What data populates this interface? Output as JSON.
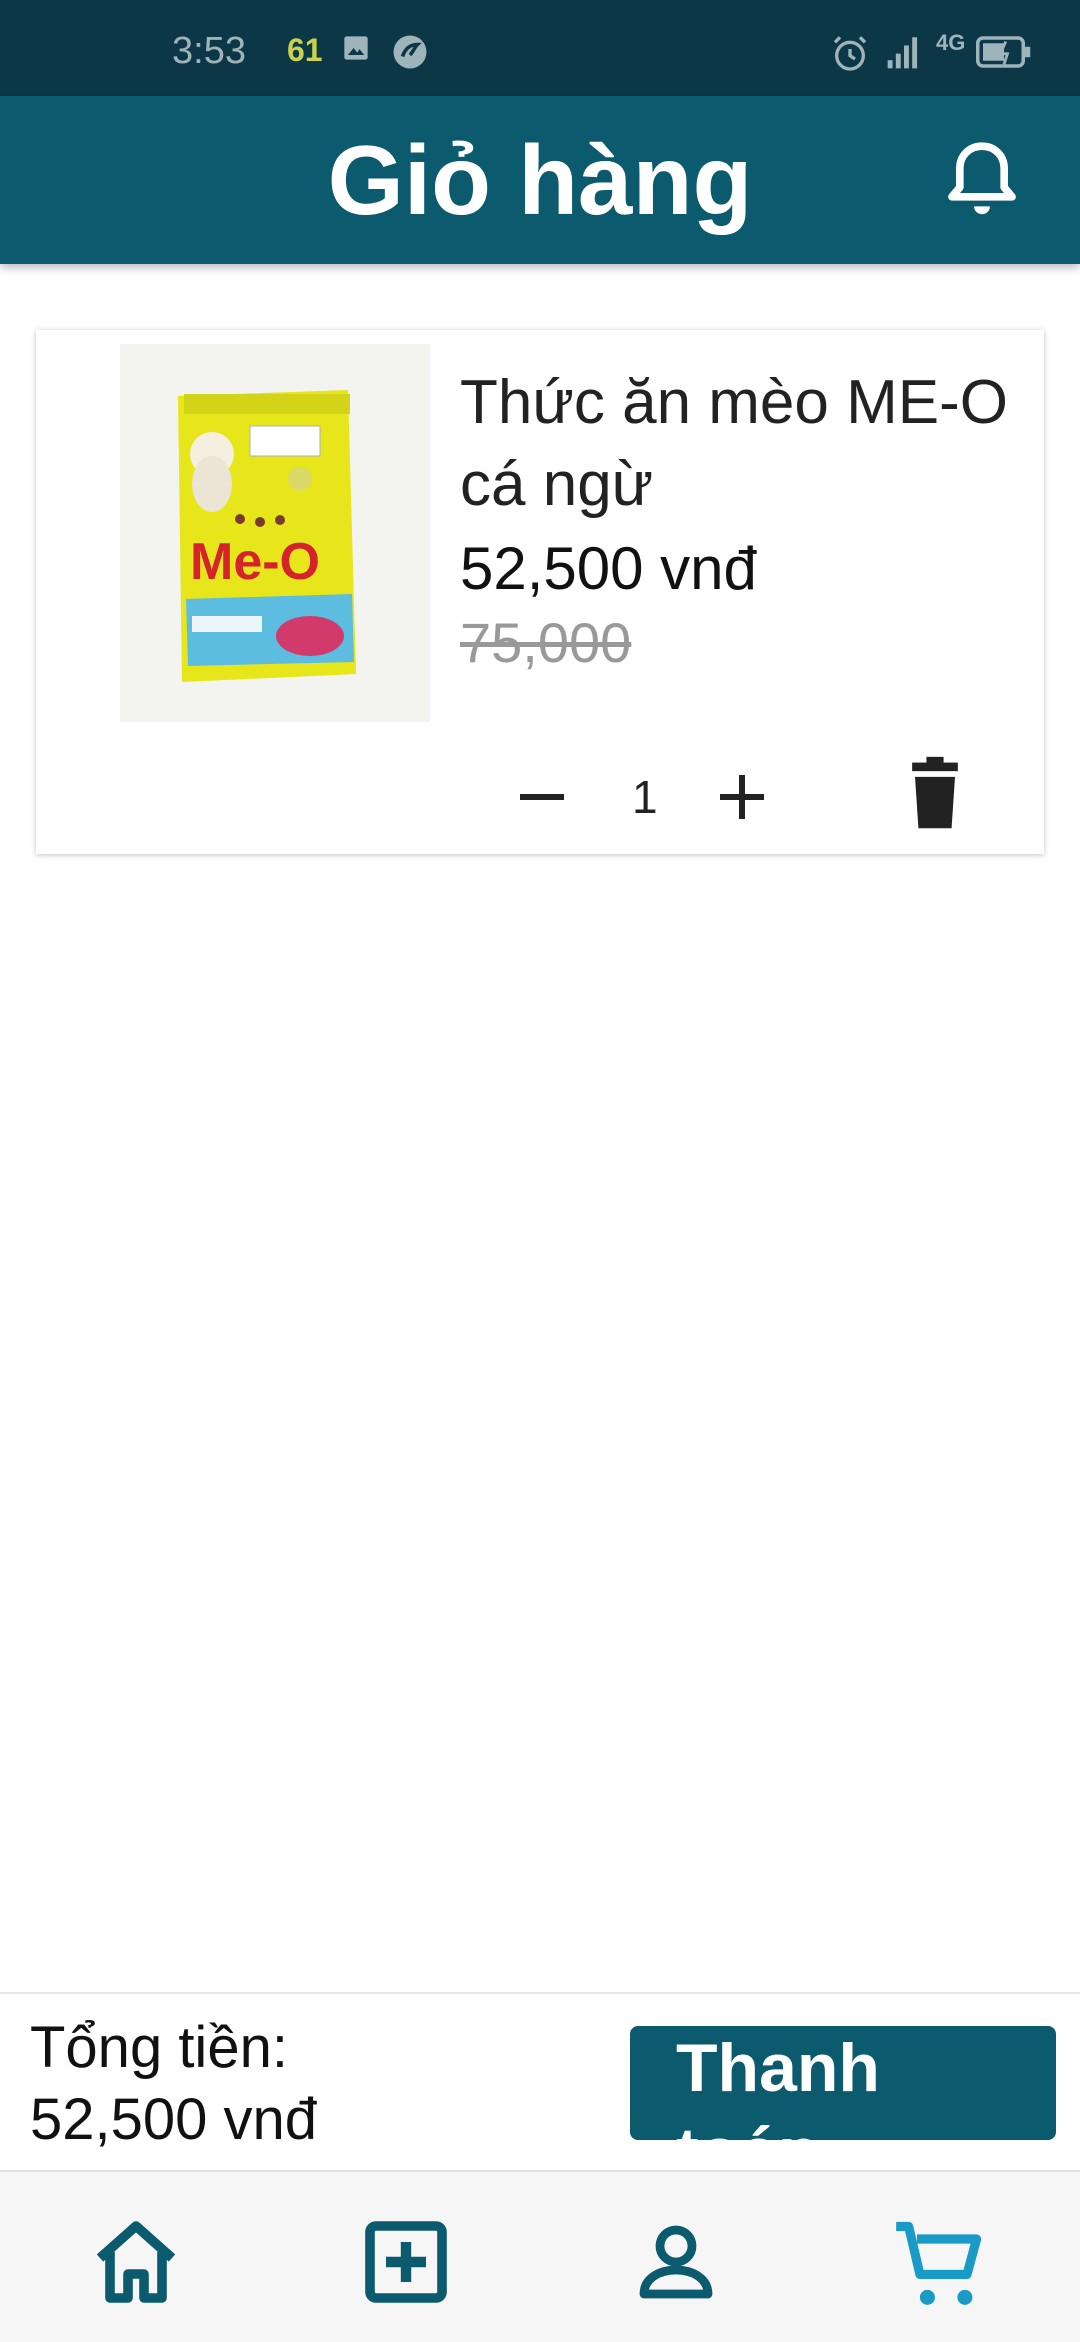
{
  "status_bar": {
    "time": "3:53",
    "badge": "61",
    "network": "4G"
  },
  "header": {
    "title": "Giỏ hàng",
    "icon": "bell-icon"
  },
  "cart": {
    "items": [
      {
        "name": "Thức ăn mèo ME-O cá ngừ",
        "price": "52,500 vnđ",
        "old_price": "75,000",
        "quantity": "1",
        "image_brand": "Me-O"
      }
    ]
  },
  "summary": {
    "total_label": "Tổng tiền:",
    "total_value": "52,500 vnđ",
    "checkout_label": "Thanh toán"
  },
  "bottom_nav": {
    "items": [
      {
        "icon": "home-icon"
      },
      {
        "icon": "add-box-icon"
      },
      {
        "icon": "account-icon"
      },
      {
        "icon": "cart-icon",
        "active": true
      }
    ]
  },
  "colors": {
    "primary": "#0b5a6e",
    "status_bar": "#0b3746",
    "active_nav": "#1a9ac7"
  }
}
